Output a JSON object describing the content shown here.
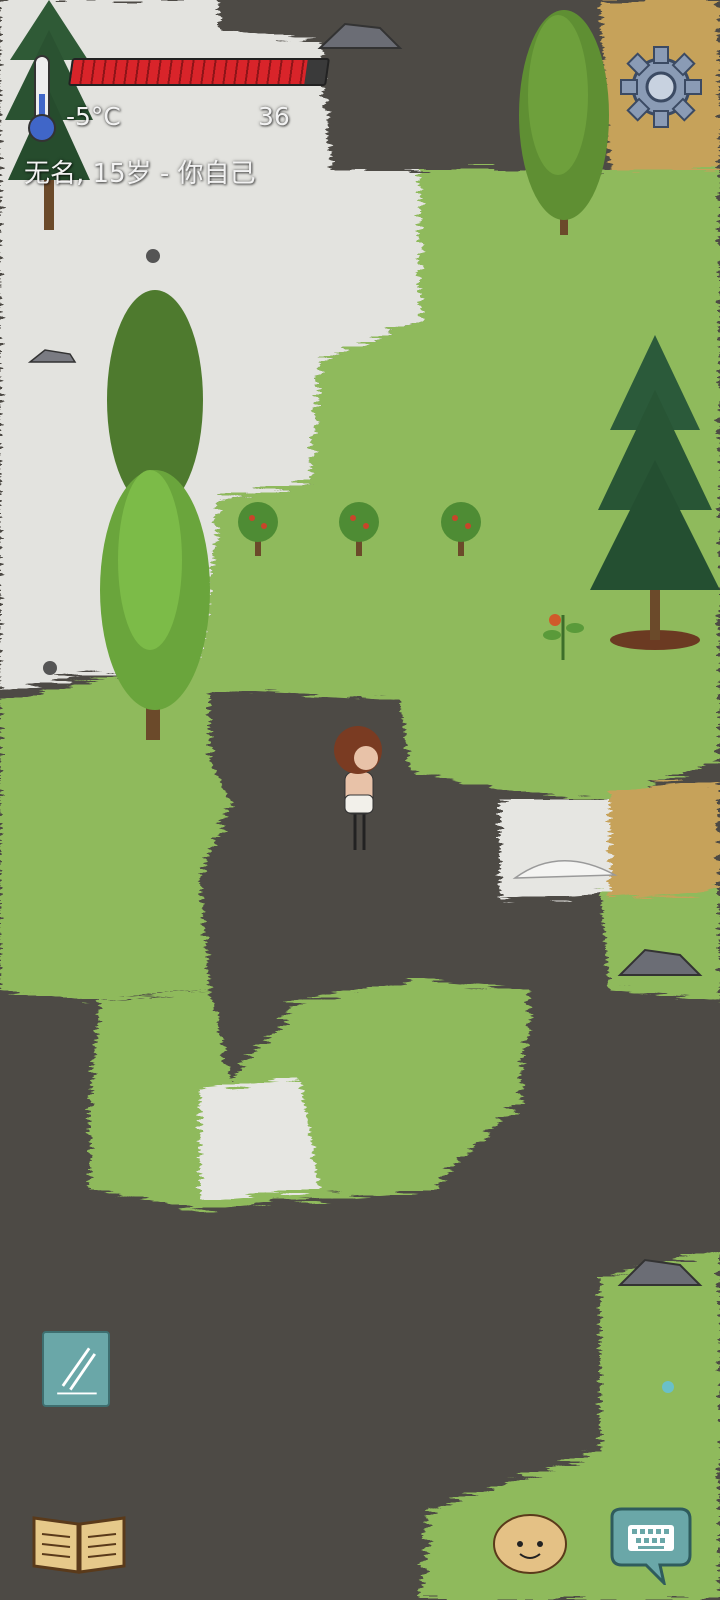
{
  "hud": {
    "temperature": "-5°C",
    "counter": "36",
    "character_line": "无名, 15岁 - 你自己",
    "health_fraction": 0.92
  },
  "colors": {
    "grass": "#8fba5c",
    "dirt": "#4d4a45",
    "snow": "#e6e6e2",
    "dry_grass": "#c6a25a",
    "health_red": "#d9242a",
    "button_teal": "#6aa7a8"
  },
  "icons": {
    "thermometer": "thermometer-icon",
    "settings": "gear-icon",
    "pencil": "pencil-icon",
    "book": "book-icon",
    "emote": "smiley-face-icon",
    "keyboard": "keyboard-icon"
  }
}
